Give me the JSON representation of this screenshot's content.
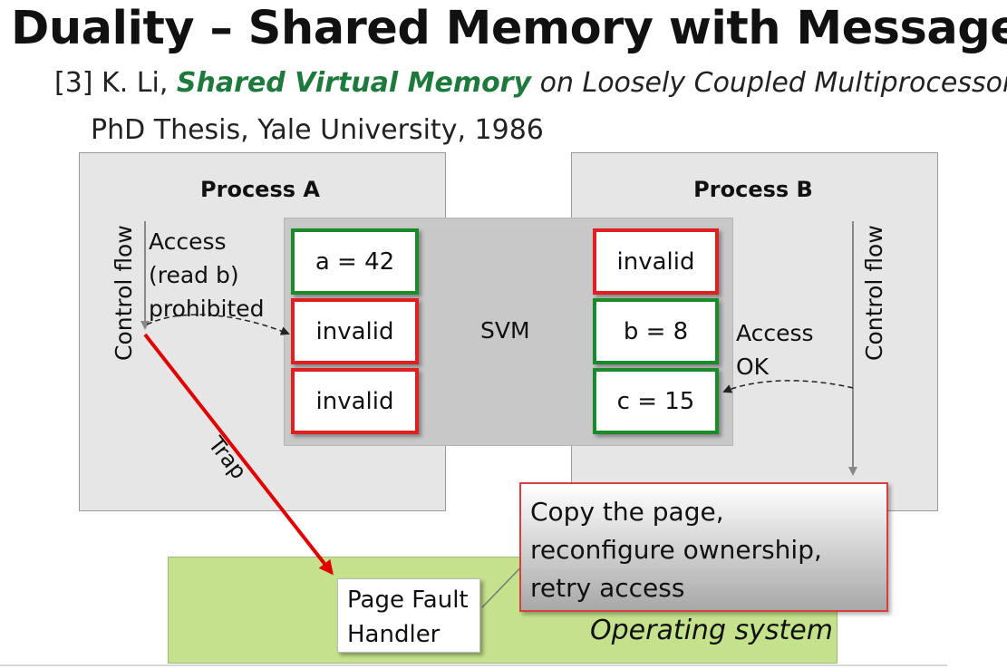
{
  "slide": {
    "title": "Duality – Shared Memory with Messages",
    "citation": {
      "prefix": "[3] K. Li, ",
      "highlight": "Shared Virtual Memory",
      "suffix": " on Loosely Coupled Multiprocessors,",
      "line2": "PhD Thesis, Yale University, 1986"
    }
  },
  "diagram": {
    "process_a": {
      "title": "Process A",
      "control_flow": "Control flow",
      "access_lines": [
        "Access",
        "(read b)",
        "prohibited"
      ]
    },
    "process_b": {
      "title": "Process B",
      "control_flow": "Control flow",
      "access_lines": [
        "Access",
        "OK"
      ]
    },
    "svm": {
      "label": "SVM",
      "a_pages": [
        {
          "text": "a = 42",
          "state": "valid"
        },
        {
          "text": "invalid",
          "state": "invalid"
        },
        {
          "text": "invalid",
          "state": "invalid"
        }
      ],
      "b_pages": [
        {
          "text": "invalid",
          "state": "invalid"
        },
        {
          "text": "b = 8",
          "state": "valid"
        },
        {
          "text": "c = 15",
          "state": "valid"
        }
      ]
    },
    "trap_label": "Trap",
    "handler_lines": [
      "Page Fault",
      "Handler"
    ],
    "callout_lines": [
      "Copy the page,",
      "reconfigure ownership,",
      "retry access"
    ],
    "os_label": "Operating system",
    "colors": {
      "valid_border": "#1b8a2a",
      "invalid_border": "#e02020",
      "trap_arrow": "#e00000",
      "os_fill": "#c4e28b",
      "citation_highlight": "#1e7a3c"
    }
  }
}
